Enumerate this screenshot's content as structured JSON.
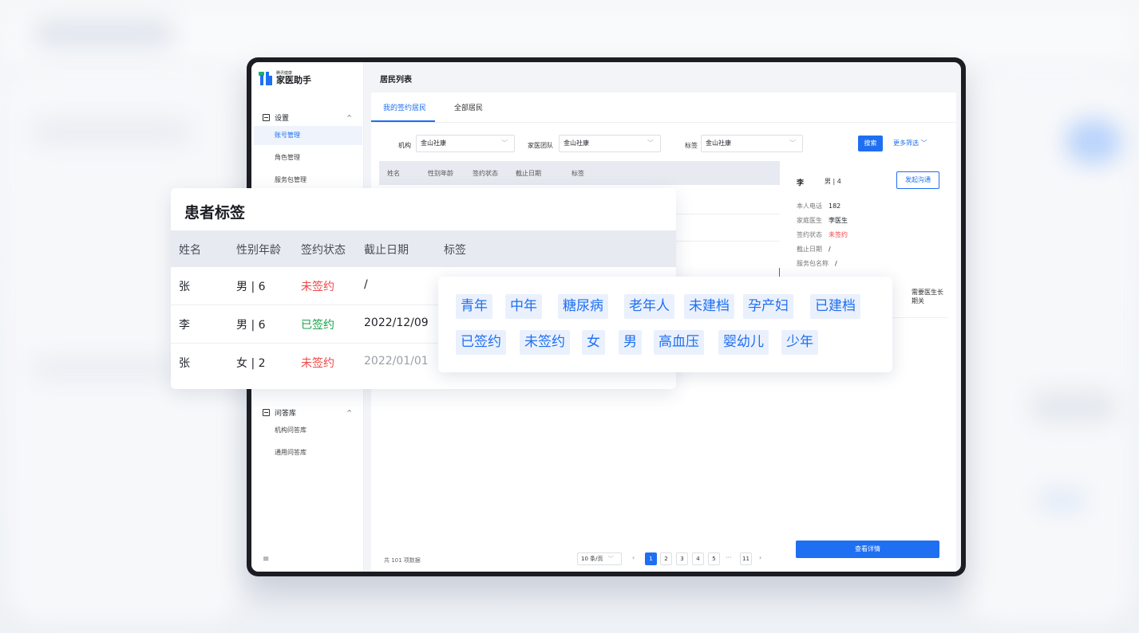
{
  "app": {
    "logo_sub": "腾讯健康",
    "logo_main": "家医助手"
  },
  "sidebar": {
    "group_settings": "设置",
    "items": [
      "账号管理",
      "角色管理",
      "服务包管理"
    ],
    "group_qa": "问答库",
    "qa_items": [
      "机构问答库",
      "通用问答库"
    ],
    "menu_glyph": "≡",
    "caret_glyph": "^"
  },
  "page": {
    "title": "居民列表",
    "tabs": [
      "我的签约居民",
      "全部居民"
    ]
  },
  "filters": {
    "org_label": "机构",
    "org_value": "金山社康",
    "team_label": "家医团队",
    "team_value": "金山社康",
    "tag_label": "标签",
    "tag_value": "金山社康",
    "search_label": "搜索",
    "more_label": "更多筛选",
    "chevron": "﹀"
  },
  "mini_table": {
    "headers": [
      "姓名",
      "性别年龄",
      "签约状态",
      "截止日期",
      "标签"
    ]
  },
  "pagination": {
    "total": "共 101 项数据",
    "page_size": "10 条/页",
    "prev": "‹",
    "pages": [
      "1",
      "2",
      "3",
      "4",
      "5"
    ],
    "ellipsis": "···",
    "last": "11",
    "next": "›"
  },
  "detail_panel": {
    "name": "李",
    "gender_age": "男 | 4",
    "start_chat": "发起沟通",
    "phone_label": "本人电话",
    "phone_value": "182",
    "doctor_label": "家庭医生",
    "doctor_value": "李医生",
    "status_label": "签约状态",
    "status_value": "未签约",
    "deadline_label": "截止日期",
    "deadline_value": "/",
    "package_label": "服务包名称",
    "package_value": "/",
    "note": "需要医生长期关",
    "view_detail": "查看详情"
  },
  "patient_tags_card": {
    "title": "患者标签",
    "headers": [
      "姓名",
      "性别年龄",
      "签约状态",
      "截止日期",
      "标签"
    ],
    "rows": [
      {
        "name": "张",
        "gender_age": "男 | 6",
        "status": "未签约",
        "deadline": "/"
      },
      {
        "name": "李",
        "gender_age": "男 | 6",
        "status": "已签约",
        "deadline": "2022/12/09"
      },
      {
        "name": "张",
        "gender_age": "女 | 2",
        "status": "未签约",
        "deadline": "2022/01/01"
      }
    ]
  },
  "tag_options": [
    "青年",
    "中年",
    "糖尿病",
    "老年人",
    "未建档",
    "孕产妇",
    "已建档",
    "已签约",
    "未签约",
    "女",
    "男",
    "高血压",
    "婴幼儿",
    "少年"
  ],
  "colors": {
    "accent": "#1f6ff2",
    "danger": "#f04747",
    "success": "#16a34a",
    "tag_bg": "#eaf1fd"
  }
}
